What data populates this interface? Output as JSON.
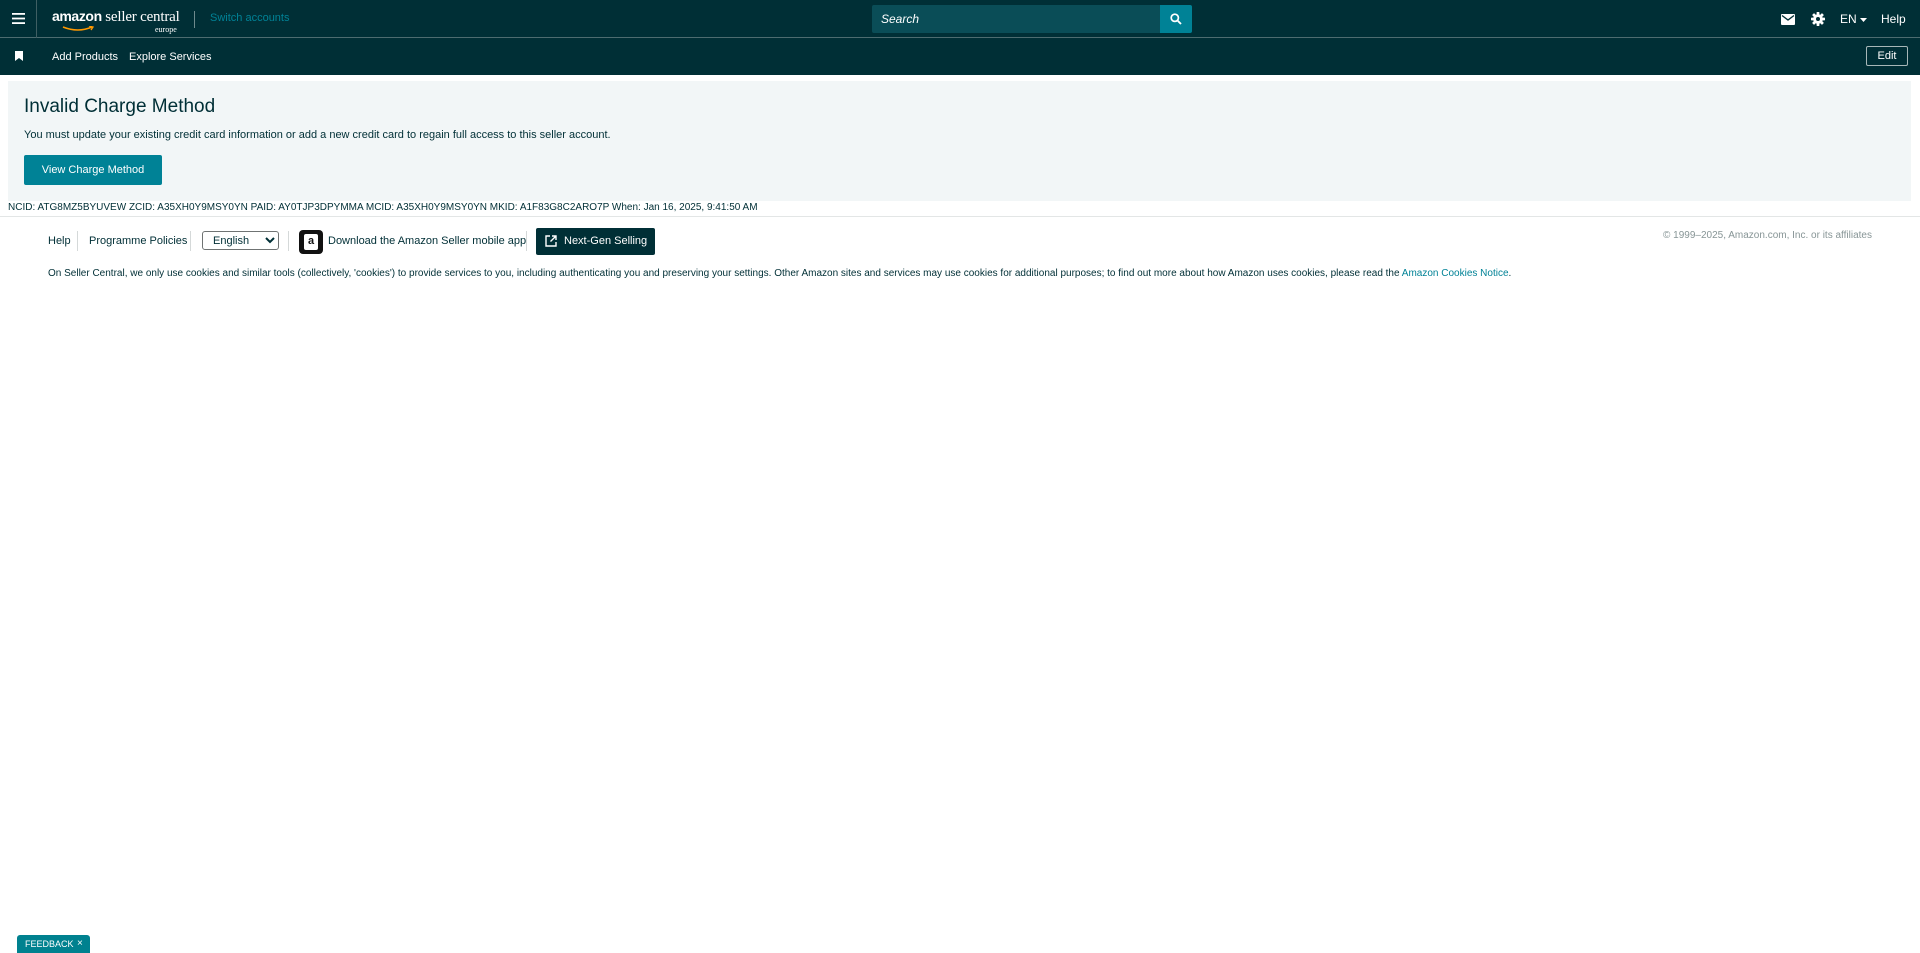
{
  "topbar": {
    "logo_main": "amazon",
    "logo_sub": "seller central",
    "logo_region": "europe",
    "switch_accounts": "Switch accounts",
    "search_placeholder": "Search",
    "language": "EN",
    "help": "Help",
    "icons": [
      "menu-icon",
      "search-icon",
      "mail-icon",
      "gear-icon",
      "chevron-down-icon"
    ]
  },
  "subbar": {
    "links": [
      "Add Products",
      "Explore Services"
    ],
    "edit_label": "Edit"
  },
  "alert": {
    "title": "Invalid Charge Method",
    "message": "You must update your existing credit card information or add a new credit card to regain full access to this seller account.",
    "button_label": "View Charge Method"
  },
  "ids_line": "NCID: ATG8MZ5BYUVEW ZCID: A35XH0Y9MSY0YN PAID: AY0TJP3DPYMMA MCID: A35XH0Y9MSY0YN MKID: A1F83G8C2ARO7P When: Jan 16, 2025, 9:41:50 AM",
  "footer": {
    "help": "Help",
    "policies": "Programme Policies",
    "language_selected": "English",
    "download_app": "Download the Amazon Seller mobile app",
    "app_icon_letter": "a",
    "next_gen": "Next-Gen Selling",
    "copyright": "© 1999–2025, Amazon.com, Inc. or its affiliates",
    "cookie_text": "On Seller Central, we only use cookies and similar tools (collectively, 'cookies') to provide services to you, including authenticating you and preserving your settings. Other Amazon sites and services may use cookies for additional purposes; to find out more about how Amazon uses cookies, please read the ",
    "cookie_link": "Amazon Cookies Notice",
    "cookie_end": "."
  },
  "feedback": {
    "label": "FEEDBACK",
    "close": "×"
  },
  "colors": {
    "nav_bg": "#002f36",
    "accent": "#008296",
    "alert_bg": "#f2f6f7"
  }
}
